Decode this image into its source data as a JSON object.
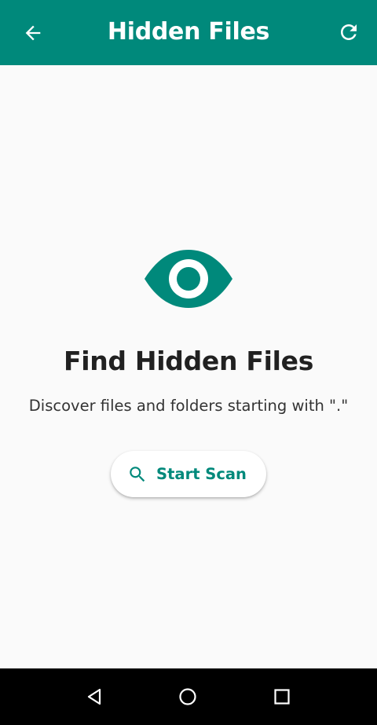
{
  "app_bar": {
    "title": "Hidden Files",
    "back_icon": "arrow-back-icon",
    "refresh_icon": "refresh-icon",
    "background": "#00897b"
  },
  "empty_state": {
    "icon": "eye-icon",
    "heading": "Find Hidden Files",
    "subtitle": "Discover files and folders starting with \".\"",
    "scan_button": {
      "label": "Start Scan",
      "icon": "search-icon"
    }
  },
  "system_nav": {
    "back_icon": "nav-back-triangle-icon",
    "home_icon": "nav-home-circle-icon",
    "recents_icon": "nav-recents-square-icon"
  },
  "colors": {
    "accent": "#00897b",
    "background": "#fafafa",
    "text": "#212121"
  }
}
